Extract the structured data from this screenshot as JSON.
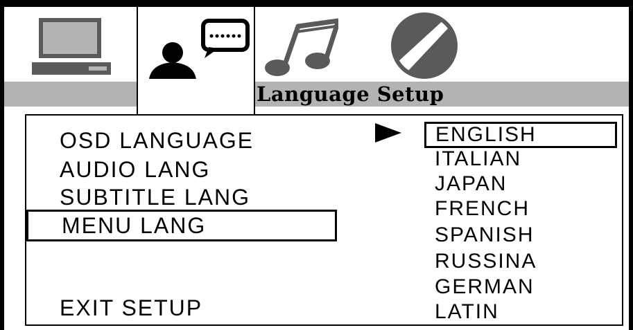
{
  "tabs": [
    {
      "icon": "monitor-icon"
    },
    {
      "icon": "person-speech-icon",
      "active": true
    },
    {
      "icon": "music-note-icon"
    },
    {
      "icon": "circle-slash-icon"
    }
  ],
  "header": {
    "title": "Language Setup",
    "band_color": "#b3b3b3"
  },
  "menu": {
    "items": [
      {
        "label": "OSD LANGUAGE"
      },
      {
        "label": "AUDIO LANG"
      },
      {
        "label": "SUBTITLE LANG"
      },
      {
        "label": "MENU LANG",
        "selected": true
      }
    ],
    "exit_label": "EXIT SETUP"
  },
  "options": {
    "pointer_icon": "right-triangle-icon",
    "items": [
      "ENGLISH",
      "ITALIAN",
      "JAPAN",
      "FRENCH",
      "SPANISH",
      "RUSSINA",
      "GERMAN",
      "LATIN"
    ],
    "selected_index": 0
  }
}
